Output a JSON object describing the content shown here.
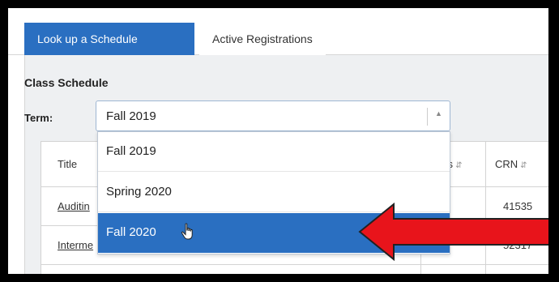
{
  "tabs": [
    {
      "label": "Look up a Schedule",
      "active": true
    },
    {
      "label": "Active Registrations",
      "active": false
    }
  ],
  "section": {
    "title": "Class Schedule"
  },
  "term": {
    "label": "Term:",
    "value": "Fall 2019"
  },
  "table": {
    "headers": [
      "Title",
      "urs",
      "CRN"
    ],
    "rows": [
      {
        "title": "Auditin",
        "crn": "41535"
      },
      {
        "title": "Interme",
        "crn": "52317"
      }
    ]
  },
  "dropdown": {
    "options": [
      "Fall 2019",
      "Spring 2020",
      "Fall 2020"
    ],
    "highlighted": "Fall 2020"
  },
  "colors": {
    "accent": "#2a6fc1",
    "arrow": "#e8141b"
  },
  "icons": {
    "sort": "sort-icon",
    "cursor": "hand-pointer-icon",
    "select": "chevron-up-icon"
  }
}
